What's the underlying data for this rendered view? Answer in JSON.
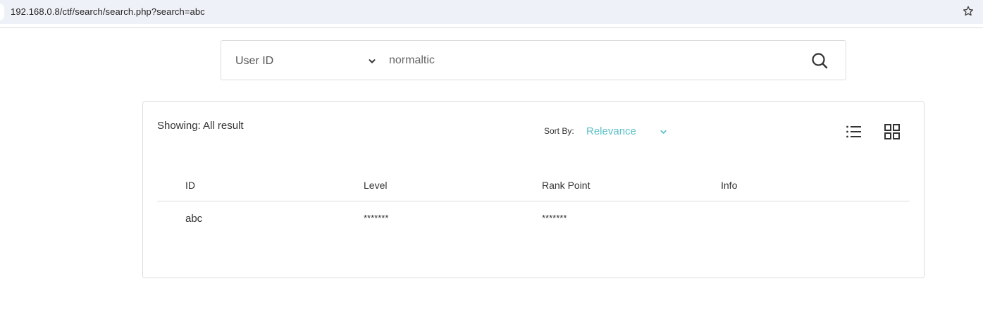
{
  "browser": {
    "url": "192.168.0.8/ctf/search/search.php?search=abc",
    "bookmark_icon": "star-icon"
  },
  "search": {
    "field_selected": "User ID",
    "query_value": "normaltic",
    "submit_icon": "search-icon"
  },
  "results": {
    "showing_text": "Showing: All result",
    "sort_label": "Sort By:",
    "sort_value": "Relevance",
    "accent_color": "#5bc0c8",
    "view_icons": [
      "list-view-icon",
      "grid-view-icon"
    ],
    "columns": [
      "ID",
      "Level",
      "Rank Point",
      "Info"
    ],
    "rows": [
      {
        "id": "abc",
        "level": "*******",
        "rank_point": "*******",
        "info": ""
      }
    ]
  }
}
